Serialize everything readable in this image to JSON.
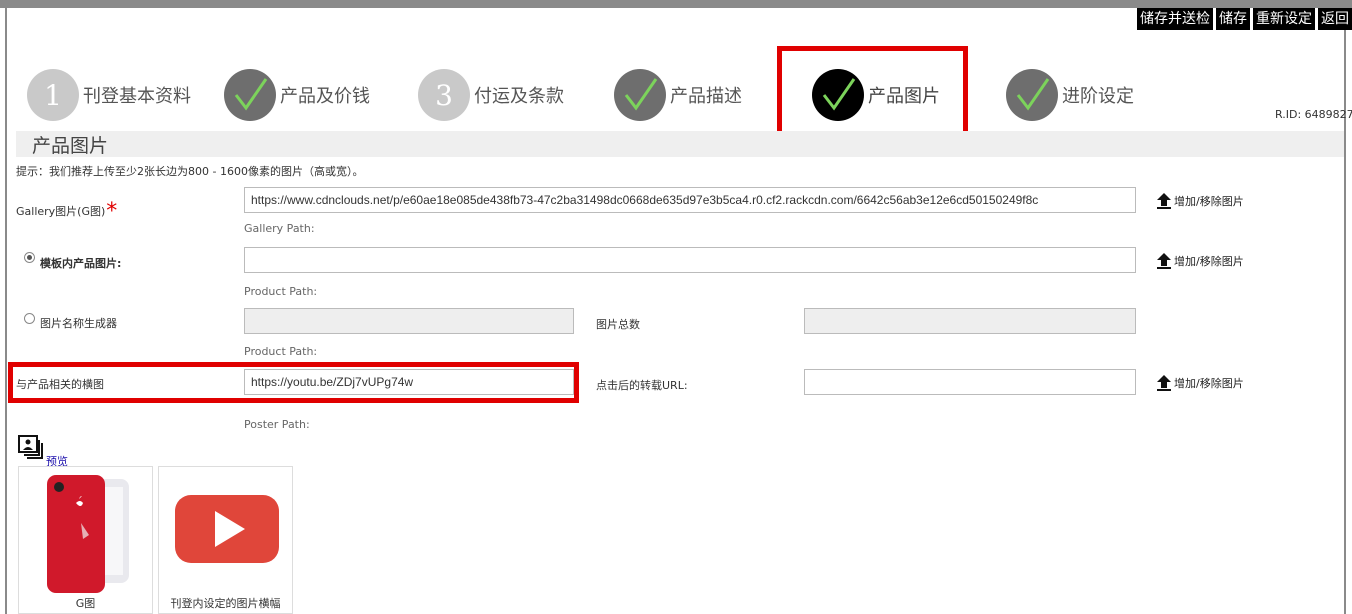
{
  "actions": {
    "save_and_check": "储存并送检",
    "save": "储存",
    "reset": "重新设定",
    "back": "返回"
  },
  "steps": [
    {
      "label": "刊登基本资料",
      "state": "number",
      "number": "1"
    },
    {
      "label": "产品及价钱",
      "state": "done"
    },
    {
      "label": "付运及条款",
      "state": "number",
      "number": "3"
    },
    {
      "label": "产品描述",
      "state": "done"
    },
    {
      "label": "产品图片",
      "state": "active"
    },
    {
      "label": "进阶设定",
      "state": "done"
    }
  ],
  "rid": "R.ID: 6489827",
  "section": {
    "title": "产品图片",
    "hint": "提示：我们推荐上传至少2张长边为800 - 1600像素的图片（高或宽）。"
  },
  "form": {
    "gallery": {
      "label": "Gallery图片(G图)",
      "required_mark": "*",
      "value": "https://www.cdnclouds.net/p/e60ae18e085de438fb73-47c2ba31498dc0668de635d97e3b5ca4.r0.cf2.rackcdn.com/6642c56ab3e12e6cd50150249f8c",
      "sub": "Gallery Path:",
      "upload": "增加/移除图片"
    },
    "template_image": {
      "label": "模板内产品图片:",
      "value": "",
      "sub": "Product Path:",
      "upload": "增加/移除图片",
      "selected": true
    },
    "name_generator": {
      "label": "图片名称生成器",
      "value": "",
      "count_label": "图片总数",
      "count_value": "",
      "sub": "Product Path:",
      "selected": false
    },
    "related_banner": {
      "label": "与产品相关的横图",
      "value": "https://youtu.be/ZDj7vUPg74w",
      "url_label": "点击后的转载URL:",
      "url_value": "",
      "sub": "Poster Path:",
      "upload": "增加/移除图片"
    }
  },
  "preview": {
    "link": "预览",
    "thumbs": [
      {
        "caption": "G图",
        "icon": "red-phone-image"
      },
      {
        "caption": "刊登内设定的图片横幅",
        "icon": "youtube-play-icon"
      }
    ]
  },
  "colors": {
    "highlight": "#e00000",
    "checkmark": "#7cd35b",
    "youtube": "#e0463a",
    "phone": "#d0192b"
  }
}
